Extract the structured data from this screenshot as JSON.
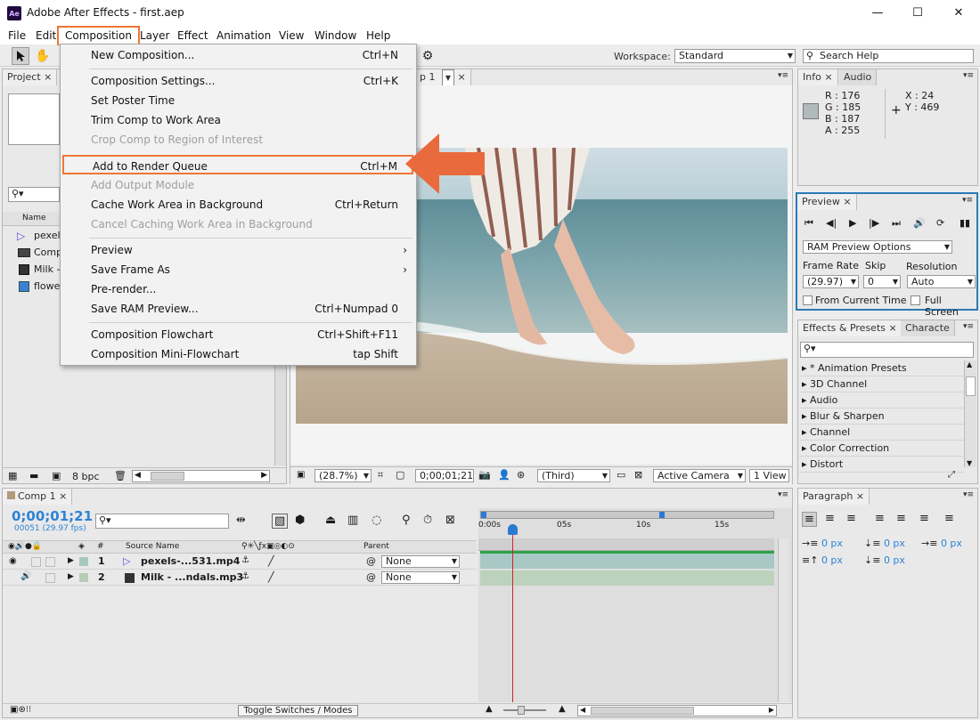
{
  "window": {
    "title": "Adobe After Effects - first.aep",
    "app_icon_text": "Ae",
    "controls": {
      "minimize": "—",
      "maximize": "☐",
      "close": "✕"
    }
  },
  "menubar": {
    "items": [
      "File",
      "Edit",
      "Composition",
      "Layer",
      "Effect",
      "Animation",
      "View",
      "Window",
      "Help"
    ],
    "active": "Composition"
  },
  "toolbar": {
    "workspace_label": "Workspace:",
    "workspace_value": "Standard",
    "search_placeholder": "Search Help"
  },
  "composition_menu": {
    "items": [
      {
        "label": "New Composition...",
        "shortcut": "Ctrl+N",
        "enabled": true
      },
      {
        "label": "Composition Settings...",
        "shortcut": "Ctrl+K",
        "enabled": true
      },
      {
        "label": "Set Poster Time",
        "shortcut": "",
        "enabled": true
      },
      {
        "label": "Trim Comp to Work Area",
        "shortcut": "",
        "enabled": true
      },
      {
        "label": "Crop Comp to Region of Interest",
        "shortcut": "",
        "enabled": false
      },
      {
        "label": "Add to Render Queue",
        "shortcut": "Ctrl+M",
        "enabled": true,
        "highlighted": true
      },
      {
        "label": "Add Output Module",
        "shortcut": "",
        "enabled": false
      },
      {
        "label": "Cache Work Area in Background",
        "shortcut": "Ctrl+Return",
        "enabled": true
      },
      {
        "label": "Cancel Caching Work Area in Background",
        "shortcut": "",
        "enabled": false
      },
      {
        "label": "Preview",
        "shortcut": "",
        "enabled": true,
        "submenu": true
      },
      {
        "label": "Save Frame As",
        "shortcut": "",
        "enabled": true,
        "submenu": true
      },
      {
        "label": "Pre-render...",
        "shortcut": "",
        "enabled": true
      },
      {
        "label": "Save RAM Preview...",
        "shortcut": "Ctrl+Numpad 0",
        "enabled": true
      },
      {
        "label": "Composition Flowchart",
        "shortcut": "Ctrl+Shift+F11",
        "enabled": true
      },
      {
        "label": "Composition Mini-Flowchart",
        "shortcut": "tap Shift",
        "enabled": true
      }
    ],
    "highlight_color": "#ee7633"
  },
  "project_panel": {
    "tab": "Project",
    "column_name": "Name",
    "items": [
      "pexels",
      "Comp",
      "Milk -",
      "flowe"
    ],
    "bpc": "8 bpc"
  },
  "viewer": {
    "tab_label": "p 1",
    "zoom": "(28.7%)",
    "timecode": "0;00;01;21",
    "resolution": "(Third)",
    "camera": "Active Camera",
    "view_count": "1 View"
  },
  "info_panel": {
    "tabs": [
      "Info",
      "Audio"
    ],
    "r": "R : 176",
    "g": "G : 185",
    "b": "B : 187",
    "a": "A : 255",
    "x": "X : 24",
    "y": "Y : 469",
    "swatch": "#b0b9bb"
  },
  "preview_panel": {
    "tab": "Preview",
    "ram_options": "RAM Preview Options",
    "frame_rate_label": "Frame Rate",
    "skip_label": "Skip",
    "resolution_label": "Resolution",
    "frame_rate": "(29.97)",
    "skip": "0",
    "resolution": "Auto",
    "from_current": "From Current Time",
    "full_screen": "Full Screen"
  },
  "effects_panel": {
    "tabs": [
      "Effects & Presets",
      "Characte"
    ],
    "items": [
      "* Animation Presets",
      "3D Channel",
      "Audio",
      "Blur & Sharpen",
      "Channel",
      "Color Correction",
      "Distort"
    ]
  },
  "timeline": {
    "tab": "Comp 1",
    "timecode": "0;00;01;21",
    "frame_info": "00051 (29.97 fps)",
    "source_name_header": "Source Name",
    "parent_header": "Parent",
    "hash_header": "#",
    "layers": [
      {
        "num": "1",
        "name": "pexels-...531.mp4",
        "parent": "None"
      },
      {
        "num": "2",
        "name": "Milk - ...ndals.mp3",
        "parent": "None"
      }
    ],
    "ruler": [
      "0:00s",
      "05s",
      "10s",
      "15s"
    ],
    "toggle_label": "Toggle Switches / Modes"
  },
  "paragraph_panel": {
    "tab": "Paragraph",
    "values": [
      "0 px",
      "0 px",
      "0 px",
      "0 px",
      "0 px"
    ]
  }
}
